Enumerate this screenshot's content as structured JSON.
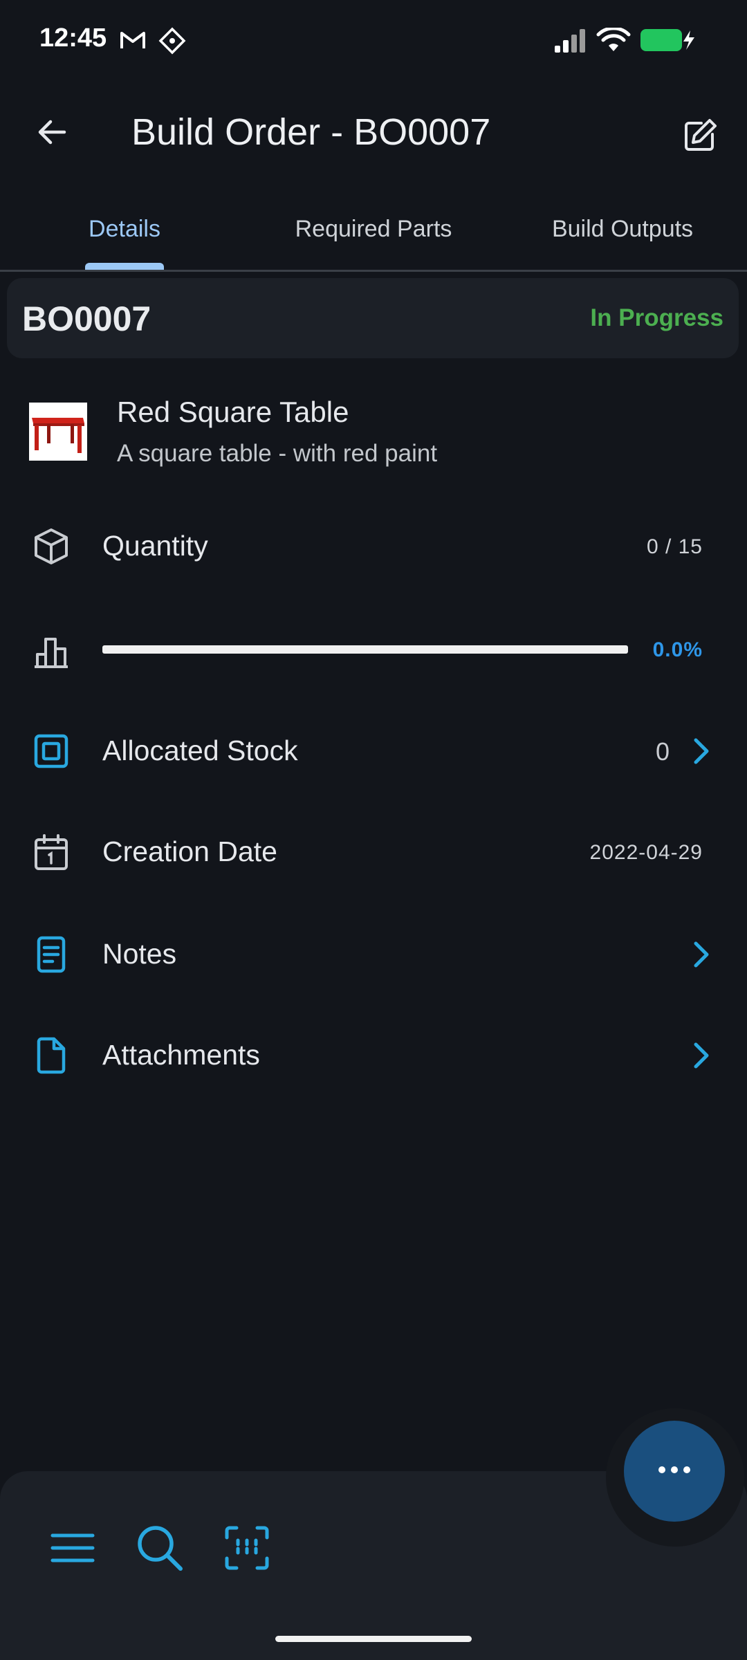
{
  "status_bar": {
    "time": "12:45",
    "icons": [
      "gmail-icon",
      "app-icon",
      "signal-icon",
      "wifi-icon",
      "battery-charging-icon"
    ],
    "battery_color": "#22c55e"
  },
  "app_bar": {
    "title": "Build Order - BO0007",
    "back_icon": "arrow-left-icon",
    "edit_icon": "edit-icon"
  },
  "tabs": [
    {
      "label": "Details",
      "active": true
    },
    {
      "label": "Required Parts",
      "active": false
    },
    {
      "label": "Build Outputs",
      "active": false
    }
  ],
  "order": {
    "reference": "BO0007",
    "status": "In Progress",
    "status_color": "#4caf50"
  },
  "part": {
    "name": "Red Square Table",
    "description": "A square table - with red paint",
    "thumbnail_icon": "red-table-image"
  },
  "details": {
    "quantity_label": "Quantity",
    "quantity_value": "0 / 15",
    "progress_text": "0.0%",
    "progress_fraction": 0.0,
    "allocated_label": "Allocated Stock",
    "allocated_value": "0",
    "creation_label": "Creation Date",
    "creation_value": "2022-04-29",
    "notes_label": "Notes",
    "attachments_label": "Attachments"
  },
  "bottom_nav": {
    "icons": [
      "menu-icon",
      "search-icon",
      "barcode-scan-icon"
    ],
    "fab_icon": "more-horizontal-icon"
  },
  "colors": {
    "accent": "#29a8e0",
    "tab_active": "#9cc8f5",
    "progress": "#2e96e8",
    "background": "#12151b"
  }
}
